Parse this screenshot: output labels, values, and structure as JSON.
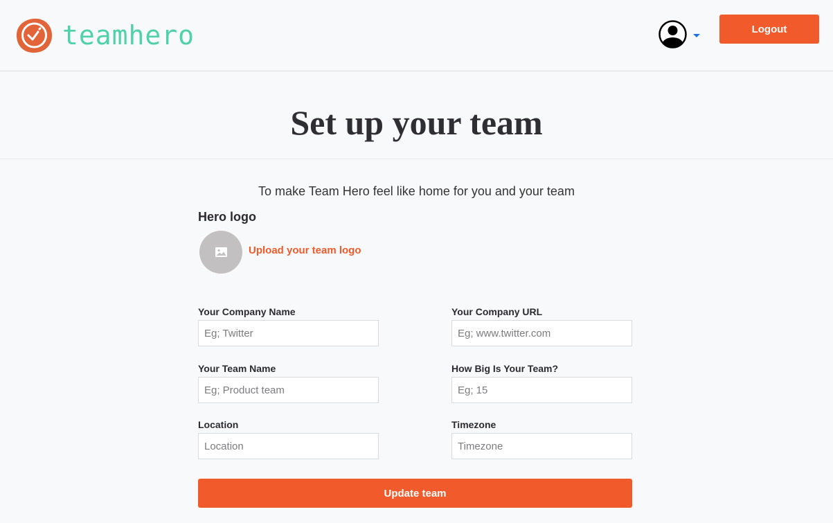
{
  "header": {
    "brand_name": "teamhero",
    "logout_label": "Logout",
    "user_menu_icon": "user-circle-icon",
    "caret_icon": "caret-down-icon"
  },
  "page": {
    "title": "Set up your team",
    "subtitle": "To make Team Hero feel like home for you and your team"
  },
  "logo_section": {
    "label": "Hero logo",
    "placeholder_icon": "image-icon",
    "upload_link": "Upload your team logo"
  },
  "fields": {
    "company_name": {
      "label": "Your Company Name",
      "placeholder": "Eg; Twitter",
      "value": ""
    },
    "company_url": {
      "label": "Your Company URL",
      "placeholder": "Eg; www.twitter.com",
      "value": ""
    },
    "team_name": {
      "label": "Your Team Name",
      "placeholder": "Eg; Product team",
      "value": ""
    },
    "team_size": {
      "label": "How Big Is Your Team?",
      "placeholder": "Eg; 15",
      "value": ""
    },
    "location": {
      "label": "Location",
      "placeholder": "Location",
      "value": ""
    },
    "timezone": {
      "label": "Timezone",
      "placeholder": "Timezone",
      "value": ""
    }
  },
  "actions": {
    "submit_label": "Update team"
  },
  "colors": {
    "accent": "#f15a2b",
    "brand_text": "#4fd1a9",
    "logo_mark": "#e2653a",
    "caret": "#1a73e8",
    "background": "#f8f9fb"
  }
}
